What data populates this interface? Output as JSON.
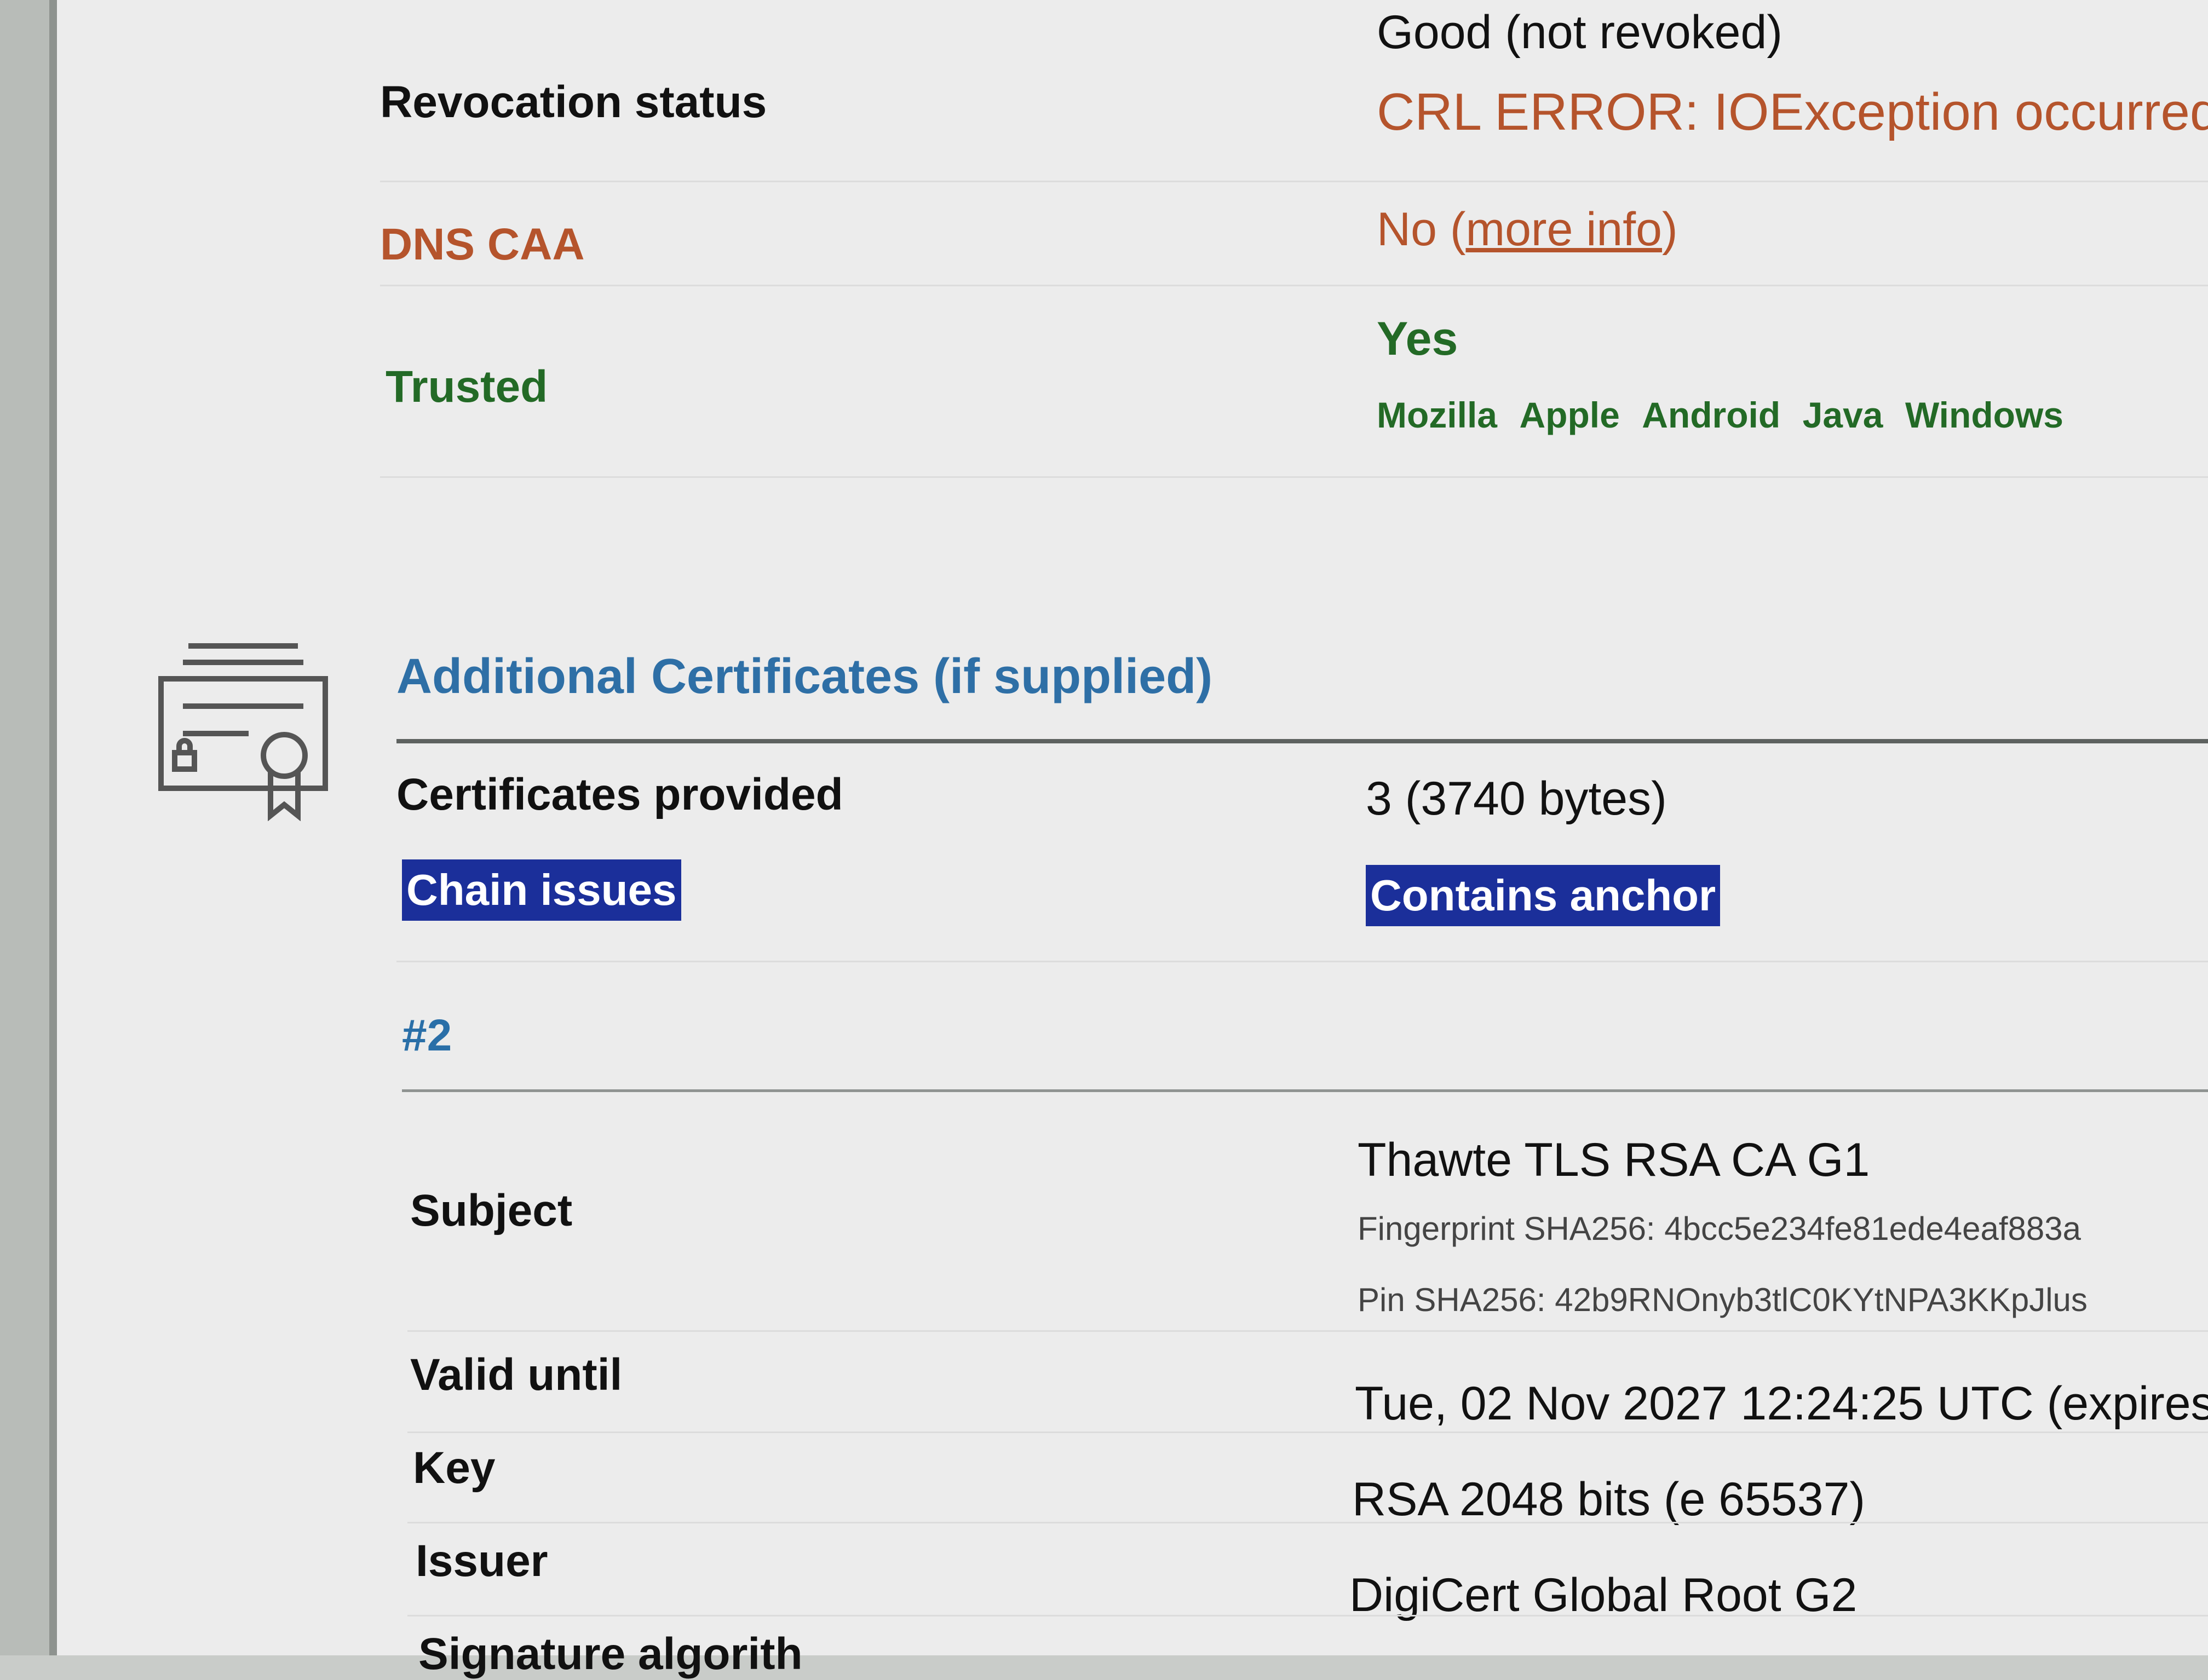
{
  "revocation": {
    "label": "Revocation status",
    "value": "Good (not revoked)",
    "error": "CRL ERROR: IOException occurred"
  },
  "dns_caa": {
    "label": "DNS CAA",
    "value": "No (",
    "link": "more info",
    "suffix": ")"
  },
  "trusted": {
    "label": "Trusted",
    "value": "Yes",
    "stores": [
      "Mozilla",
      "Apple",
      "Android",
      "Java",
      "Windows"
    ]
  },
  "additional": {
    "title": "Additional Certificates (if supplied)",
    "certificates_provided_label": "Certificates provided",
    "certificates_provided_value": "3 (3740 bytes)",
    "chain_issues_label": "Chain issues",
    "chain_issues_value": "Contains anchor"
  },
  "cert2": {
    "heading": "#2",
    "subject_label": "Subject",
    "subject_value": "Thawte TLS RSA CA G1",
    "fingerprint": "Fingerprint SHA256: 4bcc5e234fe81ede4eaf883a",
    "pin": "Pin SHA256: 42b9RNOnyb3tlC0KYtNPA3KKpJlus",
    "valid_until_label": "Valid until",
    "valid_until_value": "Tue, 02 Nov 2027 12:24:25 UTC (expires",
    "key_label": "Key",
    "key_value": "RSA 2048 bits (e 65537)",
    "issuer_label": "Issuer",
    "issuer_value": "DigiCert Global Root G2",
    "signature_label": "Signature algorith"
  },
  "colors": {
    "orange": "#b5542c",
    "green": "#236a26",
    "blue_title": "#2e6fa6",
    "badge_bg": "#1b2f9a"
  },
  "icons": {
    "certificate": "certificate-icon"
  }
}
